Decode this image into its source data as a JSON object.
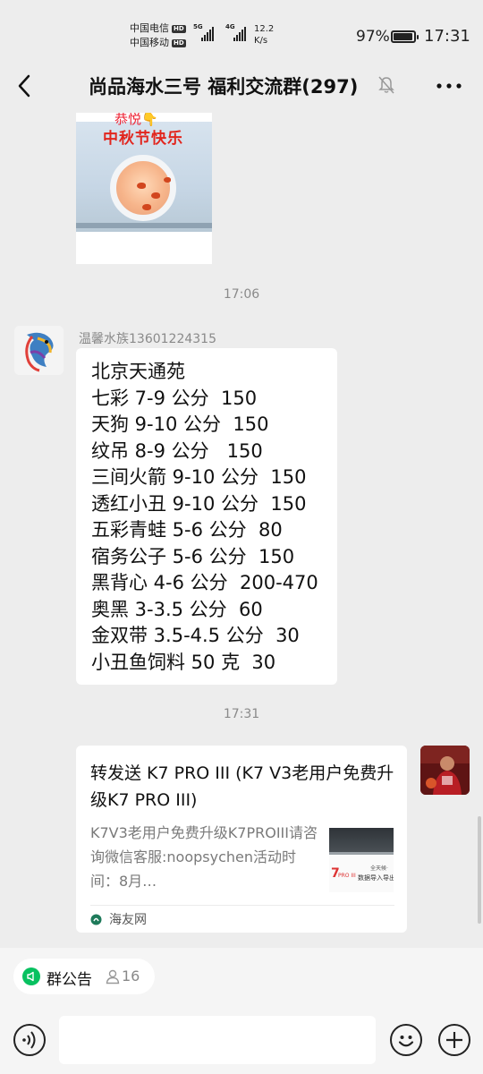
{
  "status_bar": {
    "carrier_1": "中国电信",
    "carrier_2": "中国移动",
    "hd_badge": "HD",
    "net_1": "5G",
    "net_2": "4G",
    "speed_value": "12.2",
    "speed_unit": "K/s",
    "battery_percent": "97%",
    "battery_level": 0.97,
    "time": "17:31"
  },
  "header": {
    "title": "尚品海水三号 福利交流群(297)",
    "back_icon": "back-chevron-icon",
    "mute_icon": "bell-muted-icon",
    "more_icon": "more-dots-icon"
  },
  "messages": {
    "image_message": {
      "caption_top": "恭悦👇",
      "caption": "中秋节快乐"
    },
    "time_1": "17:06",
    "text_message": {
      "sender": "温馨水族13601224315",
      "lines": [
        "北京天通苑",
        "七彩 7-9 公分  150",
        "天狗 9-10 公分  150",
        "纹吊 8-9 公分   150",
        "三间火箭 9-10 公分  150",
        "透红小丑 9-10 公分  150",
        "五彩青蛙 5-6 公分  80",
        "宿务公子 5-6 公分  150",
        "黑背心 4-6 公分  200-470",
        "奥黑 3-3.5 公分  60",
        "金双带 3.5-4.5 公分  30",
        "小丑鱼饲料 50 克  30"
      ]
    },
    "time_2": "17:31",
    "link_card": {
      "title": "转发送 K7 PRO III (K7 V3老用户免费升级K7 PRO III)",
      "description": "K7V3老用户免费升级K7PROIII请咨询微信客服:noopsychen活动时间：8月…",
      "thumb_brand": "7",
      "thumb_tag": "PRO III",
      "thumb_text": "数据导入导出",
      "thumb_small": "全天候·",
      "source": "海友网"
    }
  },
  "notice": {
    "label": "群公告",
    "count": "16",
    "icon": "announcement-icon",
    "person_icon": "person-icon"
  },
  "input_bar": {
    "voice_icon": "voice-icon",
    "emoji_icon": "emoji-icon",
    "plus_icon": "plus-icon"
  },
  "colors": {
    "background": "#ededed",
    "bubble": "#ffffff",
    "accent_green": "#07c160",
    "festive_red": "#e2251d"
  }
}
